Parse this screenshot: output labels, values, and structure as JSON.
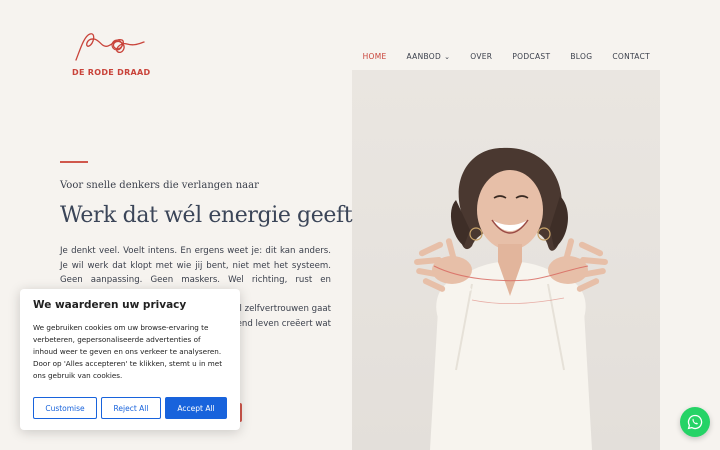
{
  "brand": {
    "name": "DE RODE DRAAD",
    "accent": "#c9433a"
  },
  "nav": {
    "items": [
      {
        "label": "HOME",
        "active": true
      },
      {
        "label": "AANBOD",
        "has_dropdown": true
      },
      {
        "label": "OVER"
      },
      {
        "label": "PODCAST"
      },
      {
        "label": "BLOG"
      },
      {
        "label": "CONTACT"
      }
    ]
  },
  "hero": {
    "tagline": "Voor snelle denkers die verlangen naar",
    "headline": "Werk dat wél energie geeft",
    "intro_1": "Je denkt veel. Voelt intens. En ergens weet je: dit kan anders. Je wil werk dat klopt met wie jij bent, niet met het systeem. Geen aanpassing. Geen maskers. Wel richting, rust en erkenning.",
    "intro_2": "zoals jij. Ik help je n en jezelf zichtbaar l zelfvertrouwen gaat kend leven creëert wat"
  },
  "cookie_banner": {
    "title": "We waarderen uw privacy",
    "body": "We gebruiken cookies om uw browse-ervaring te verbeteren, gepersonaliseerde advertenties of inhoud weer te geven en ons verkeer te analyseren. Door op 'Alles accepteren' te klikken, stemt u in met ons gebruik van cookies.",
    "customise_label": "Customise",
    "reject_label": "Reject All",
    "accept_label": "Accept All",
    "button_color": "#1863dc"
  },
  "whatsapp": {
    "icon": "whatsapp-icon",
    "color": "#25d366"
  }
}
